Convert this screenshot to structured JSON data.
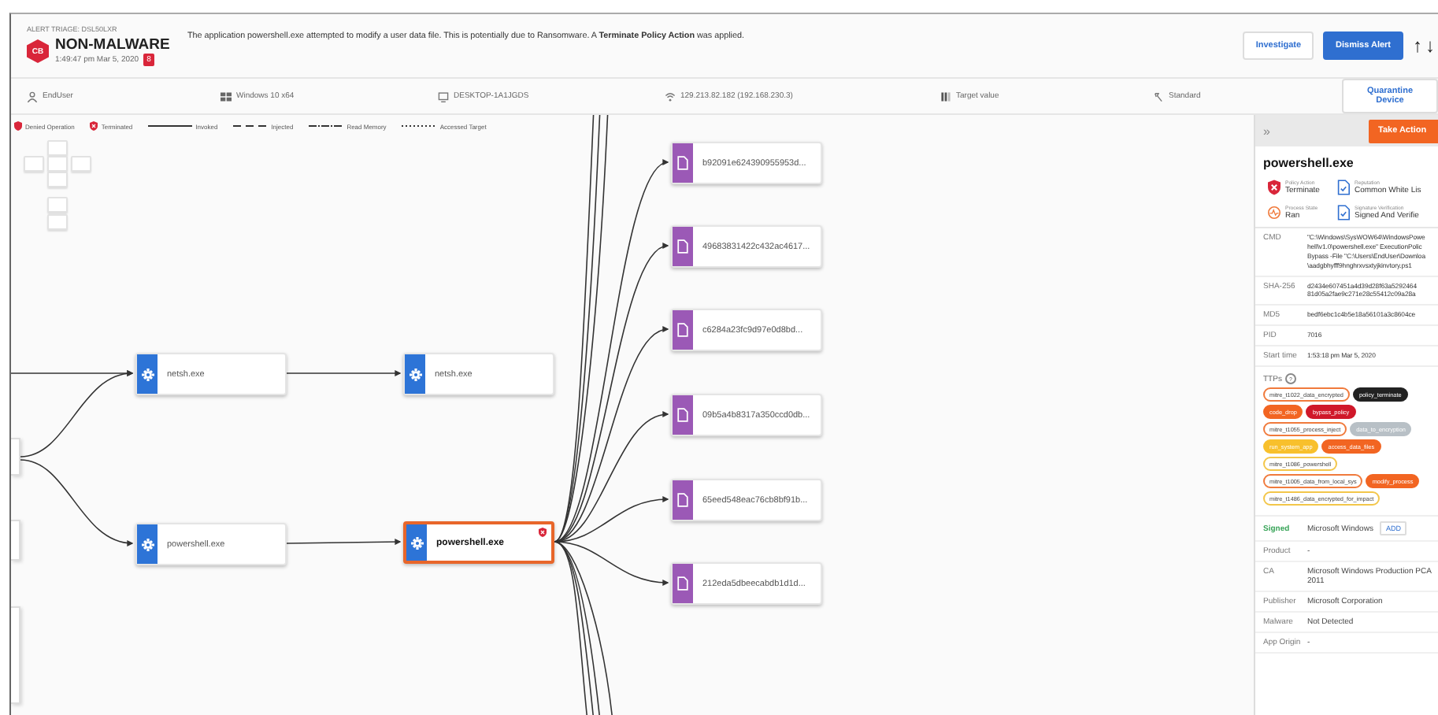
{
  "header": {
    "breadcrumb": "ALERT TRIAGE: DSL50LXR",
    "logo": "CB",
    "title": "NON-MALWARE",
    "time": "1:49:47 pm Mar 5, 2020",
    "badge": "8",
    "message": "The application powershell.exe attempted to modify a user data file. This is potentially due to Ransomware. A **Terminate Policy Action** was applied.",
    "buttons": [
      {
        "label": "Investigate",
        "kind": "secondary"
      },
      {
        "label": "Dismiss Alert",
        "kind": "primary"
      }
    ],
    "nav": [
      "↑",
      "↓"
    ]
  },
  "device_bar": {
    "items": [
      {
        "kind": "user",
        "text": "EndUser"
      },
      {
        "kind": "os",
        "text": "Windows 10 x64"
      },
      {
        "kind": "device",
        "text": "DESKTOP-1A1JGDS"
      },
      {
        "kind": "network",
        "text": "129.213.82.182 (192.168.230.3)"
      },
      {
        "kind": "target",
        "text": "Target value"
      },
      {
        "kind": "policy",
        "text": "Standard"
      }
    ],
    "button": "Quarantine Device"
  },
  "legend": [
    {
      "kind": "denied",
      "label": "Denied Operation"
    },
    {
      "kind": "terminated",
      "label": "Terminated"
    },
    {
      "kind": "invoked",
      "label": "Invoked"
    },
    {
      "kind": "injected",
      "label": "Injected"
    },
    {
      "kind": "read_memory",
      "label": "Read Memory"
    },
    {
      "kind": "accessed_target",
      "label": "Accessed Target"
    }
  ],
  "graph": {
    "nodes": [
      {
        "kind": "process",
        "label": "netsh.exe",
        "selected": false,
        "terminated": false
      },
      {
        "kind": "process",
        "label": "netsh.exe",
        "selected": false,
        "terminated": false
      },
      {
        "kind": "process",
        "label": "powershell.exe",
        "selected": false,
        "terminated": false
      },
      {
        "kind": "process",
        "label": "powershell.exe",
        "selected": true,
        "terminated": true
      },
      {
        "kind": "file",
        "label": "b92091e624390955953d...",
        "selected": false,
        "terminated": false
      },
      {
        "kind": "file",
        "label": "49683831422c432ac4617...",
        "selected": false,
        "terminated": false
      },
      {
        "kind": "file",
        "label": "c6284a23fc9d97e0d8bd...",
        "selected": false,
        "terminated": false
      },
      {
        "kind": "file",
        "label": "09b5a4b8317a350ccd0db...",
        "selected": false,
        "terminated": false
      },
      {
        "kind": "file",
        "label": "65eed548eac76cb8bf91b...",
        "selected": false,
        "terminated": false
      },
      {
        "kind": "file",
        "label": "212eda5dbeecabdb1d1d...",
        "selected": false,
        "terminated": false
      }
    ]
  },
  "panel": {
    "collapse": "»",
    "action_button": "Take Action",
    "title": "powershell.exe",
    "facts": [
      {
        "kind": "policy",
        "label": "Policy Action",
        "value": "Terminate"
      },
      {
        "kind": "reputation",
        "label": "Reputation",
        "value": "Common White Lis"
      },
      {
        "kind": "state",
        "label": "Process State",
        "value": "Ran"
      },
      {
        "kind": "signature",
        "label": "Signature Verification",
        "value": "Signed And Verifie"
      }
    ],
    "details": [
      {
        "label": "CMD",
        "lines": [
          "\"C:\\Windows\\SysWOW64\\WindowsPowe",
          "hell\\v1.0\\powershell.exe\" ExecutionPolic",
          "Bypass -File \"C:\\Users\\EndUser\\Downloa",
          "\\aadgbhyfff9hnghrxvsxtyjkinvtory.ps1"
        ]
      },
      {
        "label": "SHA-256",
        "lines": [
          "d2434e607451a4d39d28f63a5292464",
          "81d05a2fae9c271e28c55412c09a28a"
        ]
      },
      {
        "label": "MD5",
        "lines": [
          "bedf6ebc1c4b5e18a56101a3c8604ce"
        ]
      },
      {
        "label": "PID",
        "lines": [
          "7016"
        ]
      },
      {
        "label": "Start time",
        "lines": [
          "1:53:18 pm Mar 5, 2020"
        ]
      }
    ],
    "ttps_label": "TTPs",
    "ttps_help": "?",
    "ttps": [
      {
        "label": "mitre_t1022_data_encrypted",
        "kind": "outline",
        "color": "#f07a3c"
      },
      {
        "label": "policy_terminate",
        "kind": "filled",
        "color": "#222222"
      },
      {
        "label": "code_drop",
        "kind": "filled",
        "color": "#f26522"
      },
      {
        "label": "bypass_policy",
        "kind": "filled",
        "color": "#d0182a"
      },
      {
        "label": "mitre_t1055_process_inject",
        "kind": "outline",
        "color": "#f07a3c"
      },
      {
        "label": "data_to_encryption",
        "kind": "filled",
        "color": "#b8c0c6"
      },
      {
        "label": "run_system_app",
        "kind": "filled",
        "color": "#f8c02c"
      },
      {
        "label": "access_data_files",
        "kind": "filled",
        "color": "#f26522"
      },
      {
        "label": "mitre_t1086_powershell",
        "kind": "outline",
        "color": "#f3c64a"
      },
      {
        "label": "mitre_t1005_data_from_local_sys",
        "kind": "outline",
        "color": "#f07a3c"
      },
      {
        "label": "modify_process",
        "kind": "filled",
        "color": "#f26522"
      },
      {
        "label": "mitre_t1486_data_encrypted_for_impact",
        "kind": "outline",
        "color": "#f3c64a"
      }
    ],
    "signature": {
      "label": "Signed",
      "value": "Microsoft Windows",
      "button": "ADD"
    },
    "info": [
      {
        "label": "Product",
        "value": "-"
      },
      {
        "label": "CA",
        "value": "Microsoft Windows Production PCA 2011"
      },
      {
        "label": "Publisher",
        "value": "Microsoft Corporation"
      },
      {
        "label": "Malware",
        "value": "Not Detected"
      },
      {
        "label": "App Origin",
        "value": "-"
      }
    ]
  }
}
